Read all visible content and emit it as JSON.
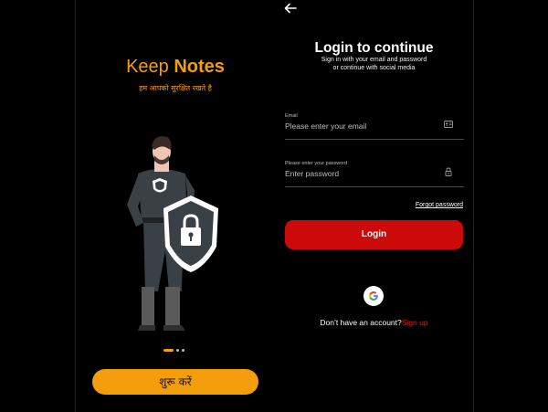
{
  "onboarding": {
    "title_plain": "Keep ",
    "title_bold": "Notes",
    "subtitle": "हम आपको सुरक्षित रखते है",
    "start_button": "शुरू करें",
    "dots_total": 3,
    "dot_active": 1
  },
  "login": {
    "heading": "Login to continue",
    "subheading_line1": "Sign in with your email and password",
    "subheading_line2": "or continue with social media",
    "email_label": "Email",
    "email_placeholder": "Please enter your email",
    "password_label": "Please enter your password",
    "password_placeholder": "Enter password",
    "forgot_password": "Forgot password",
    "login_button": "Login",
    "no_account": "Don’t have an account?",
    "signup_link": "Sign up",
    "icons": {
      "back": "arrow-left-icon",
      "email": "contact-card-icon",
      "password": "lock-icon",
      "google": "google-icon"
    }
  },
  "colors": {
    "accent_orange": "#f59e0b",
    "login_red": "#cc0a0a",
    "signup_red": "#e11d1d",
    "background": "#000000"
  }
}
